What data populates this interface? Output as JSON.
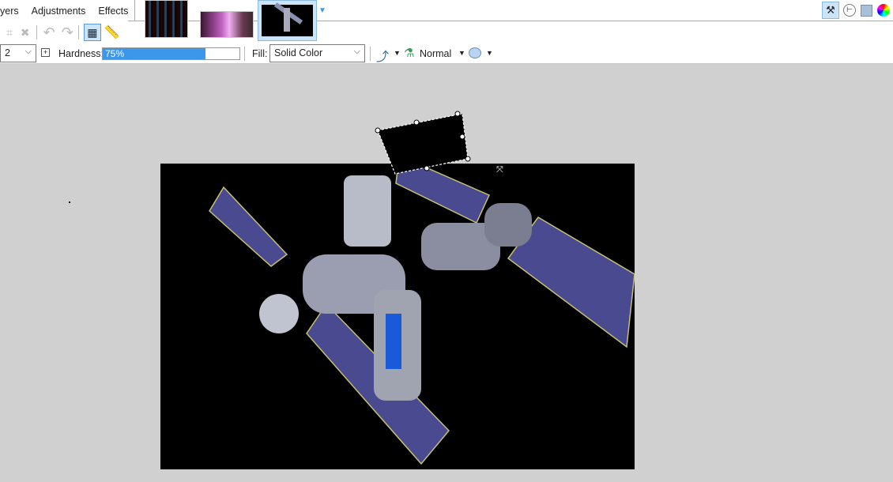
{
  "menu": {
    "layers": "yers",
    "adjustments": "Adjustments",
    "effects": "Effects"
  },
  "toolbar": {
    "brush_width": "2",
    "hardness_label": "Hardness:",
    "hardness_value": "75%",
    "hardness_percent": 75,
    "fill_label": "Fill:",
    "fill_value": "Solid Color",
    "blend_mode": "Normal"
  },
  "colors": {
    "accent": "#3c96ea",
    "canvas_bg": "#d0d0d0"
  }
}
